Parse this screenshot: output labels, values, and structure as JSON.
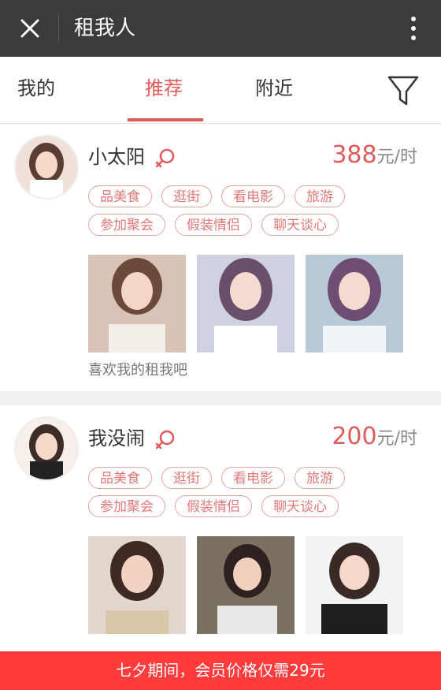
{
  "window": {
    "title": "租我人"
  },
  "tabs": [
    {
      "label": "我的",
      "active": false
    },
    {
      "label": "推荐",
      "active": true
    },
    {
      "label": "附近",
      "active": false
    }
  ],
  "colors": {
    "accent": "#e15a5a",
    "tag_border": "#e7a2a2",
    "banner": "#ff3b3b"
  },
  "profiles": [
    {
      "name": "小太阳",
      "price": {
        "value": "388",
        "unit": "元/时"
      },
      "tags": [
        "品美食",
        "逛街",
        "看电影",
        "旅游",
        "参加聚会",
        "假装情侣",
        "聊天谈心"
      ],
      "caption": "喜欢我的租我吧"
    },
    {
      "name": "我没闹",
      "price": {
        "value": "200",
        "unit": "元/时"
      },
      "tags": [
        "品美食",
        "逛街",
        "看电影",
        "旅游",
        "参加聚会",
        "假装情侣",
        "聊天谈心"
      ]
    }
  ],
  "banner": {
    "text": "七夕期间，会员价格仅需29元"
  }
}
